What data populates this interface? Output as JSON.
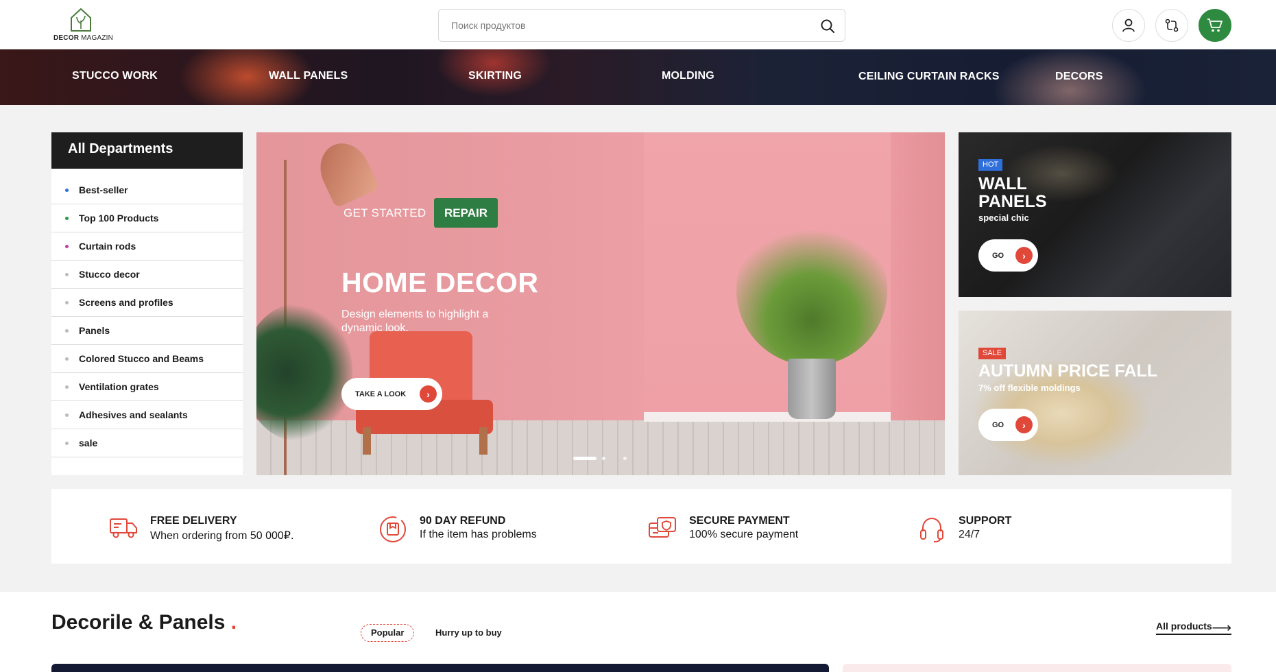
{
  "header": {
    "logo_brand": "DECOR",
    "logo_suffix": "MAGAZIN",
    "search_placeholder": "Поиск продуктов"
  },
  "category_nav": [
    "STUCCO WORK",
    "WALL PANELS",
    "SKIRTING",
    "MOLDING",
    "CEILING CURTAIN RACKS",
    "DECORS"
  ],
  "departments": {
    "title": "All Departments",
    "items": [
      {
        "label": "Best-seller",
        "dot_color": "#2f6fdc"
      },
      {
        "label": "Top 100 Products",
        "dot_color": "#2e9b45"
      },
      {
        "label": "Curtain rods",
        "dot_color": "#c040a8"
      },
      {
        "label": "Stucco decor",
        "dot_color": "#bbbbbb"
      },
      {
        "label": "Screens and profiles",
        "dot_color": "#bbbbbb"
      },
      {
        "label": "Panels",
        "dot_color": "#bbbbbb"
      },
      {
        "label": "Colored Stucco and Beams",
        "dot_color": "#bbbbbb"
      },
      {
        "label": "Ventilation grates",
        "dot_color": "#bbbbbb"
      },
      {
        "label": "Adhesives and sealants",
        "dot_color": "#bbbbbb"
      },
      {
        "label": "sale",
        "dot_color": "#bbbbbb"
      }
    ]
  },
  "hero": {
    "tagline": "GET STARTED",
    "badge": "REPAIR",
    "title": "HOME DECOR",
    "subtitle": "Design elements to highlight a dynamic look.",
    "button": "TAKE A LOOK",
    "slides": 3,
    "active_slide": 1
  },
  "promos": [
    {
      "tag": "HOT",
      "title": "WALL PANELS",
      "subtitle": "special chic",
      "button": "GO"
    },
    {
      "tag": "SALE",
      "title": "AUTUMN PRICE FALL",
      "subtitle": "7% off flexible moldings",
      "button": "GO"
    }
  ],
  "features": [
    {
      "title": "FREE DELIVERY",
      "subtitle": "When ordering from 50 000₽.",
      "icon": "delivery-truck-icon"
    },
    {
      "title": "90 DAY REFUND",
      "subtitle": "If the item has problems",
      "icon": "refund-icon"
    },
    {
      "title": "SECURE PAYMENT",
      "subtitle": "100% secure payment",
      "icon": "credit-card-icon"
    },
    {
      "title": "SUPPORT",
      "subtitle": "24/7",
      "icon": "headset-icon"
    }
  ],
  "section": {
    "title": "Decorile & Panels",
    "title_mark": ".",
    "tabs": [
      "Popular",
      "Hurry up to buy"
    ],
    "all_link": "All products"
  },
  "colors": {
    "accent_green": "#2e8a3f",
    "accent_red": "#e0483a",
    "hot_blue": "#2f6fdc"
  }
}
